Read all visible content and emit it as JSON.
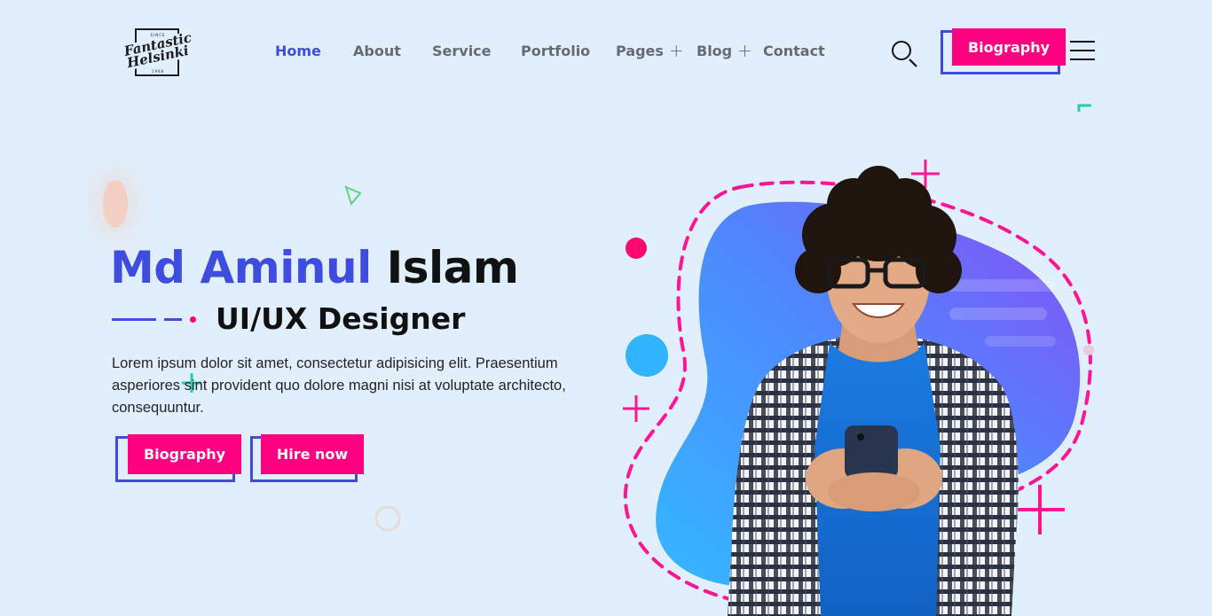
{
  "logo": {
    "since": "SINCE",
    "line1": "Fantastic",
    "line2": "Helsinki",
    "year": "1968"
  },
  "nav": {
    "items": [
      {
        "label": "Home",
        "active": true
      },
      {
        "label": "About"
      },
      {
        "label": "Service"
      },
      {
        "label": "Portfolio"
      },
      {
        "label": "Pages",
        "has_submenu": true
      },
      {
        "label": "Blog",
        "has_submenu": true
      },
      {
        "label": "Contact"
      }
    ],
    "submenu_symbol": "+"
  },
  "header": {
    "search_icon": "search-icon",
    "menu_icon": "hamburger-menu-icon",
    "cta_label": "Biography"
  },
  "hero": {
    "name_first": "Md Aminul",
    "name_last": "Islam",
    "role": "UI/UX Designer",
    "description": "Lorem ipsum dolor sit amet, consectetur adipisicing elit. Praesentium asperiores sint provident quo dolore magni nisi at voluptate architecto, consequuntur.",
    "buttons": {
      "biography": "Biography",
      "hire": "Hire now"
    }
  },
  "colors": {
    "background": "#e1effc",
    "primary": "#3e4de0",
    "accent": "#ff0080",
    "text": "#151515"
  }
}
